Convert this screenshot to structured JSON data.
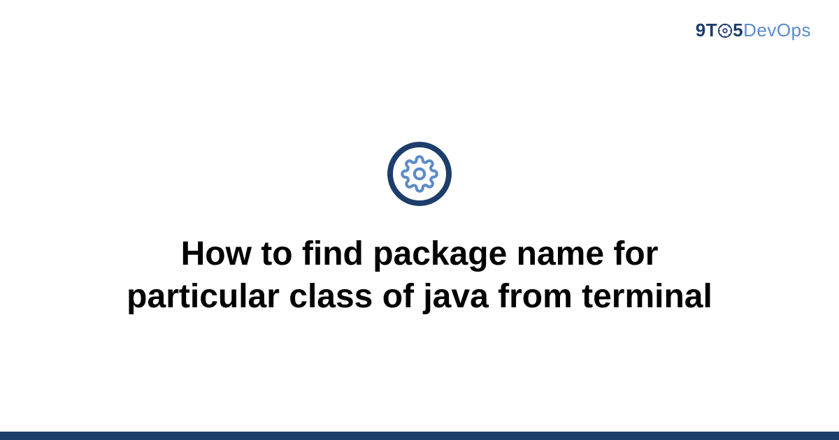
{
  "brand": {
    "part1": "9T",
    "part2": "5",
    "part3": "DevOps"
  },
  "title": "How to find package name for particular class of java from terminal",
  "colors": {
    "primary": "#1d3d6b",
    "accent": "#5b8bc9"
  }
}
